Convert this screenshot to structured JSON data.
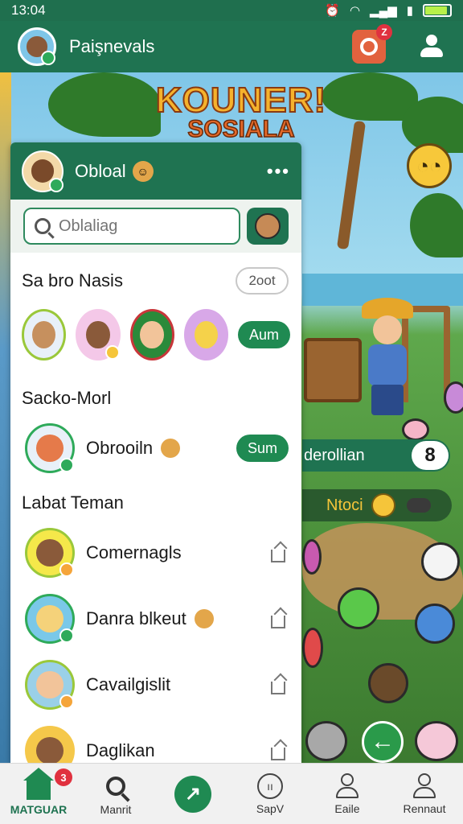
{
  "status_bar": {
    "time": "13:04",
    "icons": [
      "alarm-icon",
      "wifi-icon",
      "signal-icon",
      "sim-icon",
      "battery-icon"
    ],
    "battery_level": 0.9
  },
  "app_bar": {
    "title": "Paişnevals",
    "notification_count": "Z",
    "accent": "#1f7351"
  },
  "game": {
    "logo_line1": "KOUNER!",
    "logo_line2": "SOSIALA",
    "banner_left": "derollian",
    "banner_count": "8",
    "banner_reward": "Ntoci"
  },
  "panel": {
    "title": "Obloal",
    "search": {
      "placeholder": "Oblaliag",
      "value": "Oblaliag"
    },
    "suggested": {
      "title": "Sa bro Nasis",
      "pill": "2oot",
      "action": "Aum"
    },
    "online": {
      "title": "Sacko-Morl",
      "contact_name": "Obrooiln",
      "action": "Sum"
    },
    "friends": {
      "title": "Labat Teman",
      "items": [
        {
          "name": "Comernagls"
        },
        {
          "name": "Danra blkeut"
        },
        {
          "name": "Cavailgislit"
        },
        {
          "name": "Daglikan"
        }
      ]
    }
  },
  "bottom_nav": {
    "items": [
      {
        "label": "MATGUAR",
        "icon": "home-icon",
        "active": true,
        "badge": "3"
      },
      {
        "label": "Manrit",
        "icon": "search-icon"
      },
      {
        "label": "",
        "icon": "game-icon"
      },
      {
        "label": "SapV",
        "icon": "circle-icon"
      },
      {
        "label": "Eaile",
        "icon": "person-icon"
      },
      {
        "label": "Rennaut",
        "icon": "profile-icon"
      }
    ]
  },
  "colors": {
    "brand": "#1f7351",
    "accent_green": "#1f8a52",
    "badge_red": "#e0313f"
  }
}
